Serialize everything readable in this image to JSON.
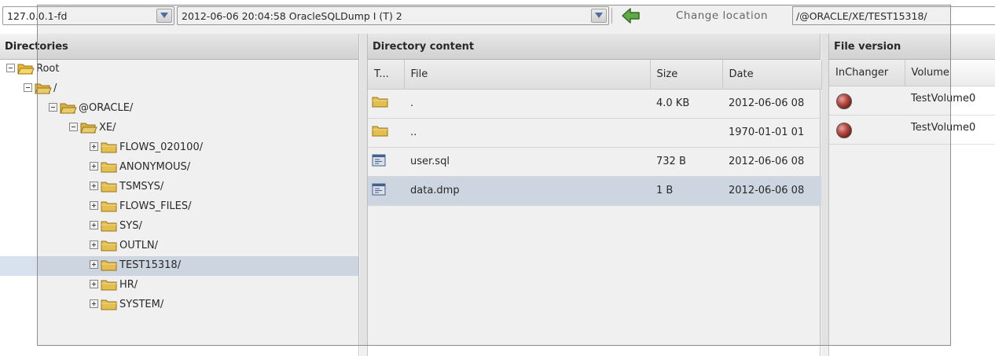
{
  "toolbar": {
    "host_select": "127.0.0.1-fd",
    "backup_select": "2012-06-06 20:04:58 OracleSQLDump I (T) 2",
    "change_location_label": "Change location",
    "location_value": "/@ORACLE/XE/TEST15318/"
  },
  "icons": {
    "back": "green-left-arrow-icon",
    "folder": "folder-icon",
    "file": "text-file-icon",
    "version": "red-ball-icon"
  },
  "colors": {
    "selection": "#d8e1ee",
    "folder_yellow": "#f3c94a",
    "arrow_green": "#3a8c2a"
  },
  "directories": {
    "title": "Directories",
    "nodes": [
      {
        "label": "Root",
        "toggle": "minus",
        "open": true
      },
      {
        "label": "/",
        "toggle": "minus",
        "open": true
      },
      {
        "label": "@ORACLE/",
        "toggle": "minus",
        "open": true
      },
      {
        "label": "XE/",
        "toggle": "minus",
        "open": true
      },
      {
        "label": "FLOWS_020100/",
        "toggle": "plus",
        "open": false
      },
      {
        "label": "ANONYMOUS/",
        "toggle": "plus",
        "open": false
      },
      {
        "label": "TSMSYS/",
        "toggle": "plus",
        "open": false
      },
      {
        "label": "FLOWS_FILES/",
        "toggle": "plus",
        "open": false
      },
      {
        "label": "SYS/",
        "toggle": "plus",
        "open": false
      },
      {
        "label": "OUTLN/",
        "toggle": "plus",
        "open": false
      },
      {
        "label": "TEST15318/",
        "toggle": "plus",
        "open": false,
        "selected": true
      },
      {
        "label": "HR/",
        "toggle": "plus",
        "open": false
      },
      {
        "label": "SYSTEM/",
        "toggle": "plus",
        "open": false
      }
    ]
  },
  "content": {
    "title": "Directory content",
    "columns": [
      "T...",
      "File",
      "Size",
      "Date"
    ],
    "rows": [
      {
        "type": "folder",
        "file": ".",
        "size": "4.0 KB",
        "date": "2012-06-06 08"
      },
      {
        "type": "folder",
        "file": "..",
        "size": "",
        "date": "1970-01-01 01"
      },
      {
        "type": "file",
        "file": "user.sql",
        "size": "732 B",
        "date": "2012-06-06 08"
      },
      {
        "type": "file",
        "file": "data.dmp",
        "size": "1 B",
        "date": "2012-06-06 08",
        "selected": true
      }
    ]
  },
  "versions": {
    "title": "File version",
    "columns": [
      "InChanger",
      "Volume"
    ],
    "rows": [
      {
        "volume": "TestVolume0"
      },
      {
        "volume": "TestVolume0"
      }
    ]
  }
}
